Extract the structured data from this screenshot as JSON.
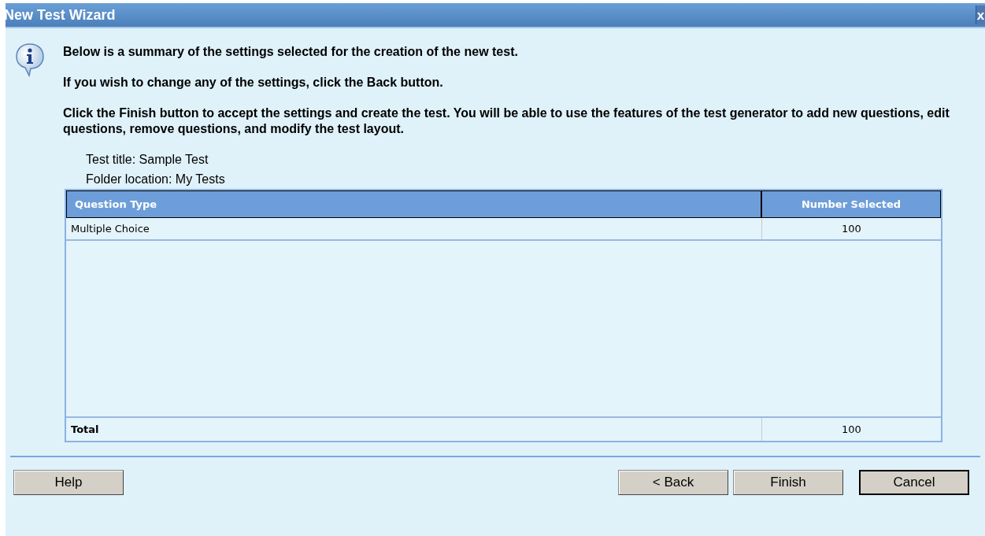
{
  "window": {
    "title": "New Test Wizard",
    "close": "x"
  },
  "messages": [
    "Below is a summary of the settings selected for the creation of the new test.",
    "If you wish to change any of the settings, click the Back button.",
    "Click the Finish button to accept the settings and create the test. You will be able to use the features of the test generator to add new questions, edit questions, remove questions, and modify the test layout."
  ],
  "details": [
    "Test title: Sample Test",
    "Folder location: My Tests"
  ],
  "table": {
    "columns": [
      "Question Type",
      "Number Selected"
    ],
    "rows": [
      [
        "Multiple Choice",
        "100"
      ]
    ],
    "footer": [
      "Total",
      "100"
    ]
  },
  "buttons": [
    {
      "label": "Help",
      "default": false
    },
    {
      "label": "< Back",
      "default": false
    },
    {
      "label": "Finish",
      "default": false
    },
    {
      "label": "Cancel",
      "default": true
    }
  ]
}
